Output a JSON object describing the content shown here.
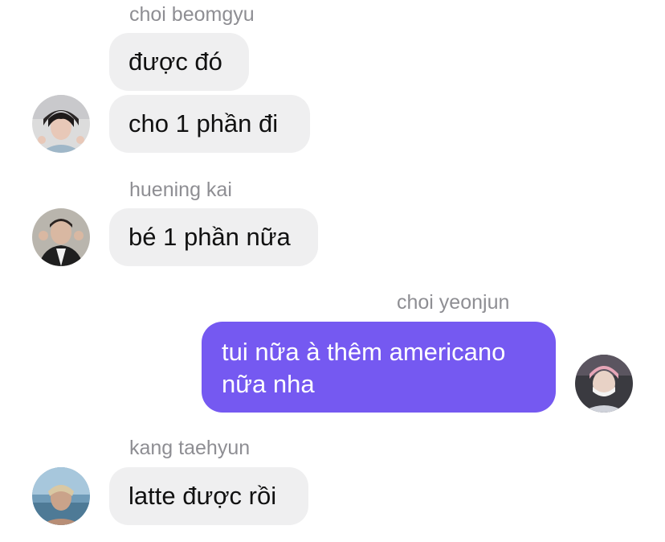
{
  "messages": [
    {
      "sender": "choi beomgyu",
      "texts": [
        "được đó",
        "cho 1 phần đi"
      ],
      "avatar_icon": "avatar-beomgyu"
    },
    {
      "sender": "huening kai",
      "texts": [
        "bé 1 phần nữa"
      ],
      "avatar_icon": "avatar-huening-kai"
    },
    {
      "sender": "choi yeonjun",
      "texts": [
        "tui nữa à thêm americano nữa nha"
      ],
      "avatar_icon": "avatar-yeonjun",
      "outgoing": true
    },
    {
      "sender": "kang taehyun",
      "texts": [
        "latte được rồi"
      ],
      "avatar_icon": "avatar-taehyun"
    }
  ],
  "colors": {
    "incoming_bubble": "#efeff0",
    "outgoing_bubble": "#7559f1",
    "sender_name": "#8e8e93"
  }
}
